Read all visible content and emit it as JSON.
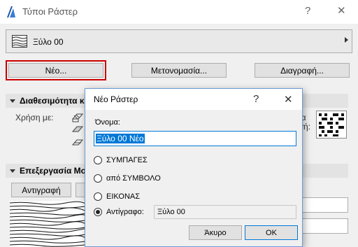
{
  "main": {
    "title": "Τύποι Ράστερ",
    "selected_raster": "Ξύλο 00",
    "buttons": {
      "new": "Νέο...",
      "rename": "Μετονομασία...",
      "delete": "Διαγραφή..."
    },
    "availability": {
      "header": "Διαθεσιμότητα κ",
      "use_with_label": "Χρήση με:",
      "right_partial_1": "ια",
      "right_partial_2": "γή:"
    },
    "editing": {
      "header": "Επεξεργασία Μο",
      "copy_button": "Αντιγραφή"
    }
  },
  "dialog": {
    "title": "Νέο Ράστερ",
    "name_label": "Όνομα:",
    "name_value": "Ξύλο 00 Νέο",
    "options": [
      {
        "label": "ΣΥΜΠΑΓΕΣ",
        "selected": false
      },
      {
        "label": "από ΣΥΜΒΟΛΟ",
        "selected": false
      },
      {
        "label": "ΕΙΚΟΝΑΣ",
        "selected": false
      },
      {
        "label": "Αντίγραφο:",
        "selected": true
      }
    ],
    "copy_source": "Ξύλο 00",
    "cancel": "Άκυρο",
    "ok": "OK"
  },
  "colors": {
    "accent_focus": "#cc0000",
    "selection_blue": "#0078d7",
    "dialog_border": "#6b9cd6"
  }
}
